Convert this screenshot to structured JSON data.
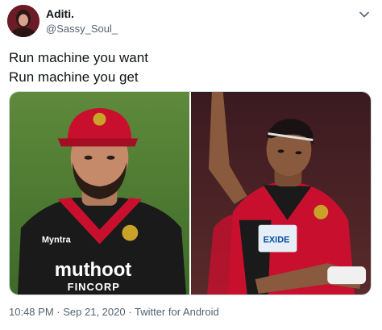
{
  "user": {
    "name": "Aditi.",
    "handle": "@Sassy_Soul_"
  },
  "tweet": {
    "lines": [
      "Run machine you want",
      "Run machine you get"
    ]
  },
  "meta": {
    "time": "10:48 PM",
    "separator": "·",
    "date": "Sep 21, 2020",
    "source": "Twitter for Android"
  },
  "media": {
    "left": {
      "jersey_text": "muthoot",
      "jersey_sub": "FINCORP",
      "sponsor": "Myntra"
    },
    "right": {
      "jersey_text": "EXIDE"
    }
  },
  "colors": {
    "text": "#0f1419",
    "muted": "#536471",
    "jersey_red": "#c8102e",
    "jersey_black": "#1a1a1a",
    "gold": "#c9a227"
  },
  "icons": {
    "menu": "chevron-down-icon"
  }
}
